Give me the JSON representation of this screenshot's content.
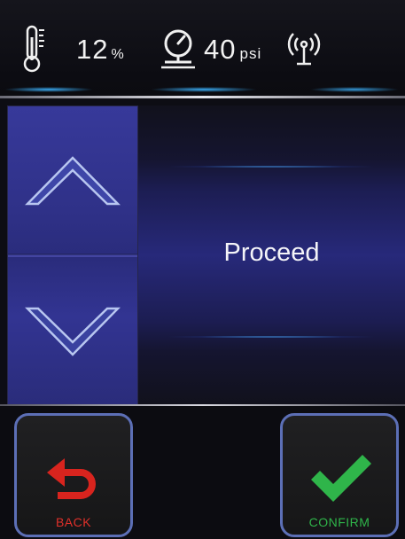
{
  "status": {
    "humidity_value": "12",
    "humidity_unit": "%",
    "pressure_value": "40",
    "pressure_unit": "psi",
    "icons": [
      "thermometer-icon",
      "pressure-gauge-icon",
      "wireless-signal-icon"
    ]
  },
  "spinner": {
    "up_icon": "chevron-up-icon",
    "down_icon": "chevron-down-icon"
  },
  "display": {
    "value": "Proceed"
  },
  "footer": {
    "back_label": "BACK",
    "back_icon": "undo-arrow-icon",
    "confirm_label": "CONFIRM",
    "confirm_icon": "checkmark-icon"
  },
  "colors": {
    "accent_blue": "#3cb4ff",
    "spinner_blue": "#2f3188",
    "button_border": "#5c6fb6",
    "back_red": "#e0302a",
    "confirm_green": "#2fb54a"
  }
}
